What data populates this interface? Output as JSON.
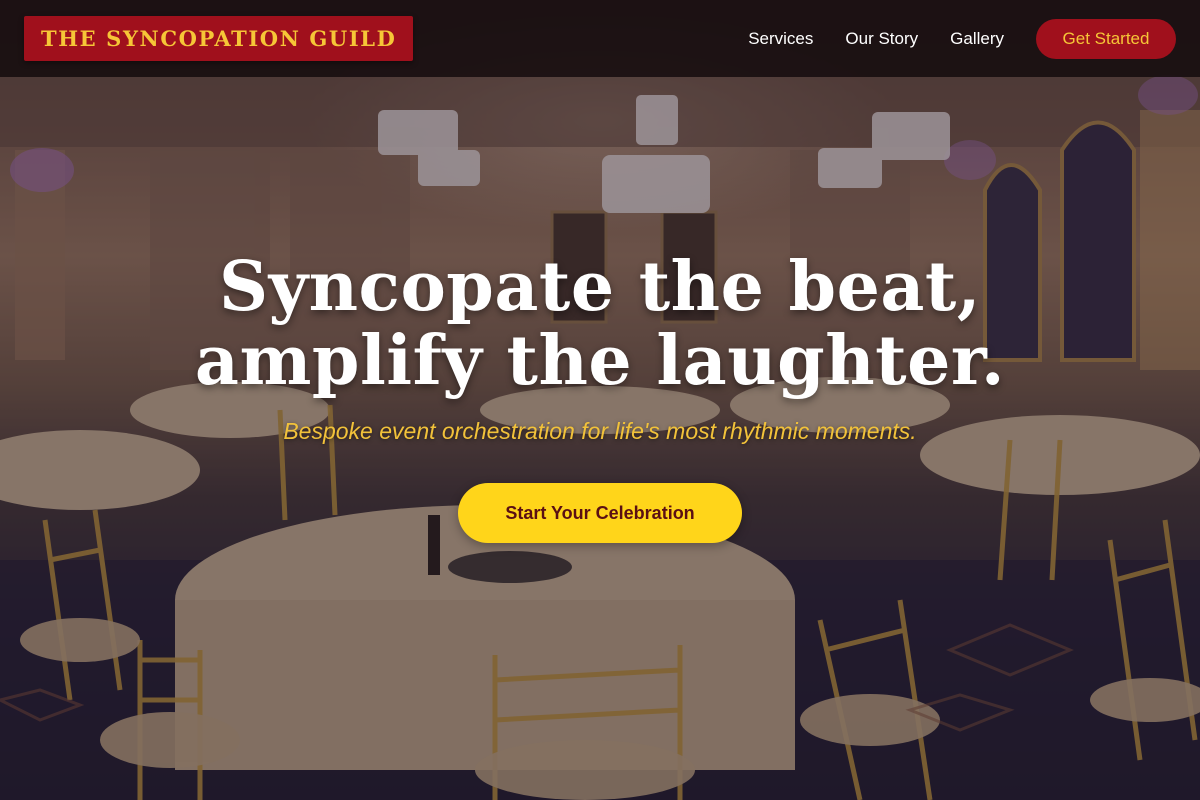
{
  "header": {
    "brand": "THE SYNCOPATION GUILD",
    "nav": [
      {
        "label": "Services"
      },
      {
        "label": "Our Story"
      },
      {
        "label": "Gallery"
      }
    ],
    "cta_label": "Get Started"
  },
  "hero": {
    "title_line1": "Syncopate the beat,",
    "title_line2": "amplify the laughter.",
    "subtitle": "Bespoke event orchestration for life's most rhythmic moments.",
    "cta_label": "Start Your Celebration",
    "background_image": "ballroom-with-chandeliers-and-round-tables"
  },
  "colors": {
    "brand_red": "#a0101c",
    "brand_gold": "#f6c637",
    "cta_yellow": "#ffd51a",
    "header_bg": "#180e10"
  }
}
